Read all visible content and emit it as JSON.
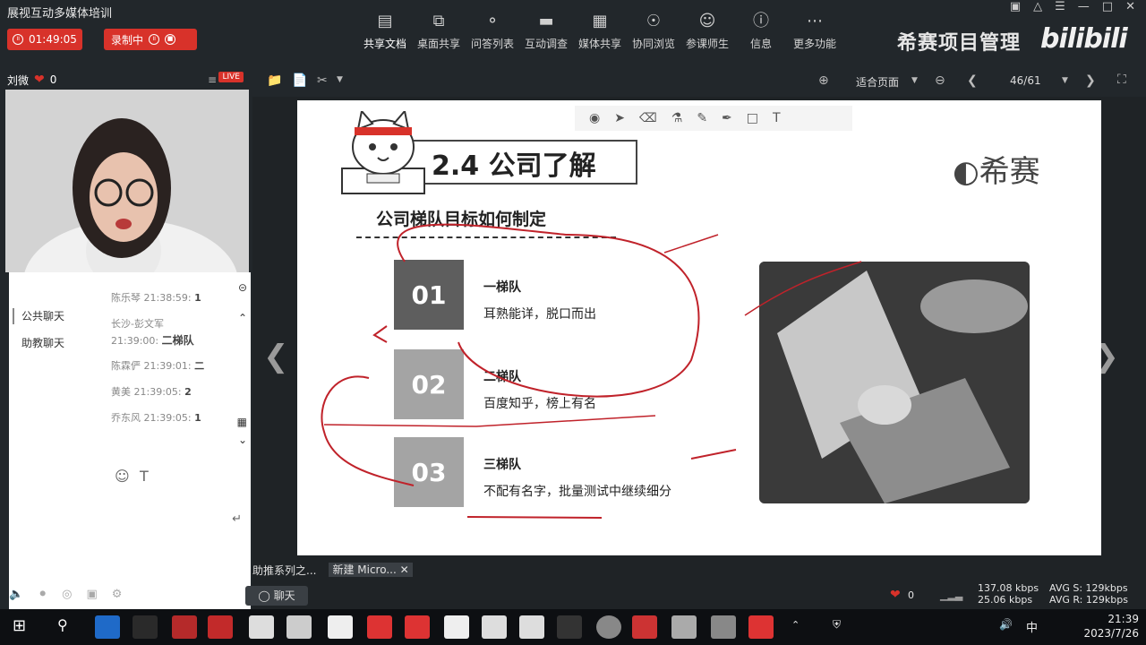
{
  "app": {
    "title": "展视互动多媒体培训",
    "timer": "01:49:05",
    "record_label": "录制中"
  },
  "toolbar": [
    {
      "label": "共享文档",
      "icon": "document-icon"
    },
    {
      "label": "桌面共享",
      "icon": "screen-share-icon"
    },
    {
      "label": "问答列表",
      "icon": "qa-icon"
    },
    {
      "label": "互动调查",
      "icon": "survey-icon"
    },
    {
      "label": "媒体共享",
      "icon": "media-icon"
    },
    {
      "label": "协同浏览",
      "icon": "browse-icon"
    },
    {
      "label": "参课师生",
      "icon": "participants-icon"
    },
    {
      "label": "信息",
      "icon": "info-icon"
    },
    {
      "label": "更多功能",
      "icon": "more-icon"
    }
  ],
  "brand": {
    "text": "希赛项目管理",
    "logo": "bilibili"
  },
  "presenter": {
    "name": "刘微",
    "likes": "0",
    "live": "LIVE"
  },
  "chat": {
    "tabs": [
      "公共聊天",
      "助教聊天"
    ],
    "messages": [
      {
        "meta": "陈乐琴 21:38:59:",
        "text": "1"
      },
      {
        "meta": "长沙-彭文军",
        "text": ""
      },
      {
        "meta": "21:39:00:",
        "text": "二梯队"
      },
      {
        "meta": "陈霖俨 21:39:01:",
        "text": "二"
      },
      {
        "meta": "黄美 21:39:05:",
        "text": "2"
      },
      {
        "meta": "乔东风 21:39:05:",
        "text": "1"
      }
    ],
    "send_label": "聊天"
  },
  "sub_tabs": [
    "助推系列之...",
    "新建 Micro..."
  ],
  "viewer": {
    "fit": "适合页面",
    "page": "46/61"
  },
  "slide": {
    "title": "2.4 公司了解",
    "logo_text": "希赛",
    "subtitle": "公司梯队目标如何制定",
    "tiers": [
      {
        "num": "01",
        "title": "一梯队",
        "desc": "耳熟能详，脱口而出"
      },
      {
        "num": "02",
        "title": "二梯队",
        "desc": "百度知乎，榜上有名"
      },
      {
        "num": "03",
        "title": "三梯队",
        "desc": "不配有名字，批量测试中继续细分"
      }
    ]
  },
  "status": {
    "likes": "0",
    "up": "137.08 kbps",
    "down": "25.06 kbps",
    "avg_s": "AVG S: 129kbps",
    "avg_r": "AVG R: 129kbps"
  },
  "taskbar": {
    "time": "21:39",
    "date": "2023/7/26",
    "ime": "中"
  },
  "colors": {
    "red": "#d8322a",
    "box1": "#5e5e5e",
    "box2": "#a4a4a4",
    "annotation": "#c0222a"
  }
}
